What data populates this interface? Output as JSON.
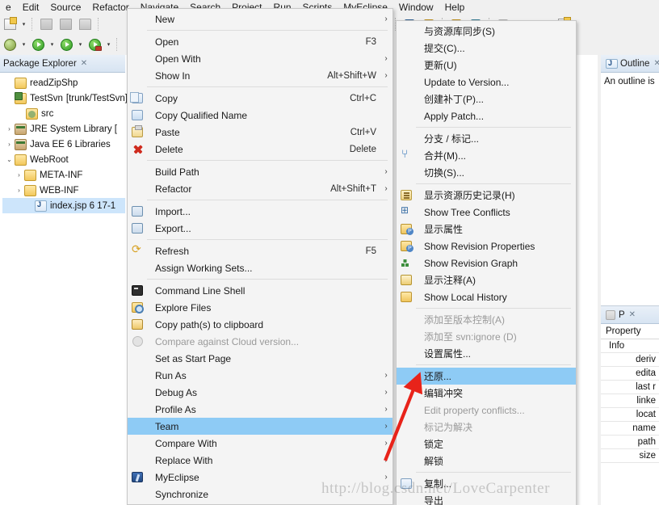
{
  "menubar": {
    "items": [
      {
        "label": "e"
      },
      {
        "label": "Edit"
      },
      {
        "label": "Source"
      },
      {
        "label": "Refactor"
      },
      {
        "label": "Navigate"
      },
      {
        "label": "Search"
      },
      {
        "label": "Project"
      },
      {
        "label": "Run"
      },
      {
        "label": "Scripts"
      },
      {
        "label": "MyEclipse"
      },
      {
        "label": "Window"
      },
      {
        "label": "Help"
      }
    ]
  },
  "package_explorer": {
    "tab_title": "Package Explorer",
    "close_glyph": "✕",
    "tree": [
      {
        "indent": 0,
        "twisty": "",
        "icon": "folder-icon",
        "label": "readZipShp",
        "dim": "",
        "selected": false
      },
      {
        "indent": 0,
        "twisty": "",
        "icon": "project-icon",
        "label": "TestSvn",
        "dim": "[trunk/TestSvn]",
        "selected": false
      },
      {
        "indent": 1,
        "twisty": "",
        "icon": "source-folder-icon",
        "label": "src",
        "dim": "",
        "selected": false
      },
      {
        "indent": 1,
        "twisty": "›",
        "icon": "library-icon",
        "label": "JRE System Library [",
        "dim": "",
        "selected": false
      },
      {
        "indent": 1,
        "twisty": "›",
        "icon": "library-icon",
        "label": "Java EE 6 Libraries",
        "dim": "",
        "selected": false
      },
      {
        "indent": 1,
        "twisty": "⌄",
        "icon": "web-folder-icon",
        "label": "WebRoot",
        "dim": "",
        "selected": false
      },
      {
        "indent": 2,
        "twisty": "›",
        "icon": "web-folder-icon",
        "label": "META-INF",
        "dim": "",
        "selected": false
      },
      {
        "indent": 2,
        "twisty": "›",
        "icon": "web-folder-icon",
        "label": "WEB-INF",
        "dim": "",
        "selected": false
      },
      {
        "indent": 3,
        "twisty": "",
        "icon": "jsp-file-icon",
        "label": "index.jsp 6  17-1",
        "dim": "",
        "selected": true
      }
    ]
  },
  "outline_panel": {
    "tab_title": "Outline",
    "message": "An outline is"
  },
  "properties_panel": {
    "tab_title": "P",
    "close_glyph": "✕",
    "header": "Property",
    "rows": [
      {
        "label": "Info",
        "level": 1
      },
      {
        "label": "deriv",
        "level": 2
      },
      {
        "label": "edita",
        "level": 2
      },
      {
        "label": "last r",
        "level": 2
      },
      {
        "label": "linke",
        "level": 2
      },
      {
        "label": "locat",
        "level": 2
      },
      {
        "label": "name",
        "level": 2
      },
      {
        "label": "path",
        "level": 2
      },
      {
        "label": "size",
        "level": 2
      }
    ]
  },
  "context_menu_main": {
    "name": "project-context-menu",
    "items": [
      {
        "label": "New",
        "accel": "",
        "arrow": true,
        "icon": "",
        "sep_after": true
      },
      {
        "label": "Open",
        "accel": "F3",
        "arrow": false,
        "icon": ""
      },
      {
        "label": "Open With",
        "accel": "",
        "arrow": true,
        "icon": ""
      },
      {
        "label": "Show In",
        "accel": "Alt+Shift+W",
        "arrow": true,
        "icon": "",
        "sep_after": true
      },
      {
        "label": "Copy",
        "accel": "Ctrl+C",
        "arrow": false,
        "icon": "copy-icon"
      },
      {
        "label": "Copy Qualified Name",
        "accel": "",
        "arrow": false,
        "icon": "copy-qualified-icon"
      },
      {
        "label": "Paste",
        "accel": "Ctrl+V",
        "arrow": false,
        "icon": "paste-icon"
      },
      {
        "label": "Delete",
        "accel": "Delete",
        "arrow": false,
        "icon": "delete-icon",
        "sep_after": true
      },
      {
        "label": "Build Path",
        "accel": "",
        "arrow": true,
        "icon": ""
      },
      {
        "label": "Refactor",
        "accel": "Alt+Shift+T",
        "arrow": true,
        "icon": "",
        "sep_after": true
      },
      {
        "label": "Import...",
        "accel": "",
        "arrow": false,
        "icon": "import-icon"
      },
      {
        "label": "Export...",
        "accel": "",
        "arrow": false,
        "icon": "export-icon",
        "sep_after": true
      },
      {
        "label": "Refresh",
        "accel": "F5",
        "arrow": false,
        "icon": "refresh-icon"
      },
      {
        "label": "Assign Working Sets...",
        "accel": "",
        "arrow": false,
        "icon": "",
        "sep_after": true
      },
      {
        "label": "Command Line Shell",
        "accel": "",
        "arrow": false,
        "icon": "shell-icon"
      },
      {
        "label": "Explore Files",
        "accel": "",
        "arrow": false,
        "icon": "explore-files-icon"
      },
      {
        "label": "Copy path(s) to clipboard",
        "accel": "",
        "arrow": false,
        "icon": "clipboard-path-icon"
      },
      {
        "label": "Compare against Cloud version...",
        "accel": "",
        "arrow": false,
        "icon": "cloud-icon",
        "disabled": true
      },
      {
        "label": "Set as Start Page",
        "accel": "",
        "arrow": false,
        "icon": ""
      },
      {
        "label": "Run As",
        "accel": "",
        "arrow": true,
        "icon": ""
      },
      {
        "label": "Debug As",
        "accel": "",
        "arrow": true,
        "icon": ""
      },
      {
        "label": "Profile As",
        "accel": "",
        "arrow": true,
        "icon": ""
      },
      {
        "label": "Team",
        "accel": "",
        "arrow": true,
        "icon": "",
        "highlighted": true
      },
      {
        "label": "Compare With",
        "accel": "",
        "arrow": true,
        "icon": ""
      },
      {
        "label": "Replace With",
        "accel": "",
        "arrow": true,
        "icon": ""
      },
      {
        "label": "MyEclipse",
        "accel": "",
        "arrow": true,
        "icon": "myeclipse-icon"
      },
      {
        "label": "Synchronize",
        "accel": "",
        "arrow": false,
        "icon": ""
      }
    ]
  },
  "context_menu_team": {
    "name": "team-submenu",
    "items": [
      {
        "label": "与资源库同步(S)",
        "icon": ""
      },
      {
        "label": "提交(C)...",
        "icon": ""
      },
      {
        "label": "更新(U)",
        "icon": ""
      },
      {
        "label": "Update to Version...",
        "icon": ""
      },
      {
        "label": "创建补丁(P)...",
        "icon": ""
      },
      {
        "label": "Apply Patch...",
        "icon": "",
        "sep_after": true
      },
      {
        "label": "分支 / 标记...",
        "icon": ""
      },
      {
        "label": "合并(M)...",
        "icon": "merge-icon"
      },
      {
        "label": "切换(S)...",
        "icon": "",
        "sep_after": true
      },
      {
        "label": "显示资源历史记录(H)",
        "icon": "history-icon"
      },
      {
        "label": "Show Tree Conflicts",
        "icon": "tree-conflicts-icon"
      },
      {
        "label": "显示属性",
        "icon": "properties-icon"
      },
      {
        "label": "Show Revision Properties",
        "icon": "revision-properties-icon"
      },
      {
        "label": "Show Revision Graph",
        "icon": "revision-graph-icon"
      },
      {
        "label": "显示注释(A)",
        "icon": "annotate-icon"
      },
      {
        "label": "Show Local History",
        "icon": "local-history-icon",
        "sep_after": true
      },
      {
        "label": "添加至版本控制(A)",
        "icon": "",
        "disabled": true
      },
      {
        "label": "添加至 svn:ignore (D)",
        "icon": "",
        "disabled": true
      },
      {
        "label": "设置属性...",
        "icon": "",
        "sep_after": true
      },
      {
        "label": "还原...",
        "icon": "",
        "highlighted": true
      },
      {
        "label": "编辑冲突",
        "icon": ""
      },
      {
        "label": "Edit property conflicts...",
        "icon": "",
        "disabled": true
      },
      {
        "label": "标记为解决",
        "icon": "",
        "disabled": true
      },
      {
        "label": "锁定",
        "icon": ""
      },
      {
        "label": "解锁",
        "icon": "",
        "sep_after": true
      },
      {
        "label": "复制...",
        "icon": "copy-small-icon"
      },
      {
        "label": "导出",
        "icon": ""
      }
    ]
  },
  "annotation": {
    "arrow_color": "#e8231a",
    "points_at": "还原..."
  },
  "watermark": {
    "text": "http://blog.csdn.net/LoveCarpenter"
  },
  "colors": {
    "menu_highlight": "#8ecbf5",
    "tree_selection": "#cde5fb",
    "menu_bg": "#f4f4f4",
    "panel_tab": "#d7e4f2"
  }
}
